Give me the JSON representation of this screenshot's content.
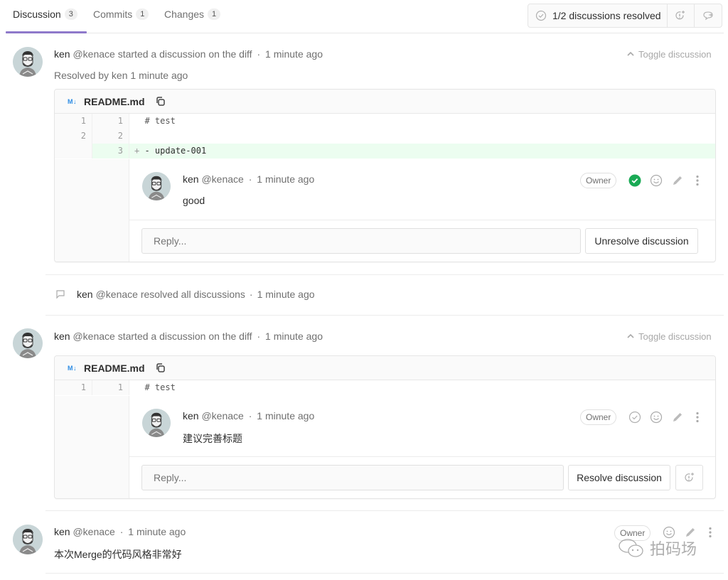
{
  "tabs": [
    {
      "label": "Discussion",
      "count": "3",
      "active": true
    },
    {
      "label": "Commits",
      "count": "1",
      "active": false
    },
    {
      "label": "Changes",
      "count": "1",
      "active": false
    }
  ],
  "resolved_status": {
    "text": "1/2 discussions resolved",
    "icons": [
      "check-circle-icon",
      "jump-to-unresolved-icon",
      "comment-next-icon"
    ]
  },
  "discussions": [
    {
      "author": "ken",
      "username": "@kenace",
      "action": "started a discussion on the diff",
      "separator": "·",
      "time": "1 minute ago",
      "resolved_text": "Resolved by ken 1 minute ago",
      "toggle_label": "Toggle discussion",
      "file": {
        "icon": "M↓",
        "name": "README.md"
      },
      "diff_lines": [
        {
          "old": "1",
          "new": "1",
          "prefix": " ",
          "text": "# test",
          "type": "context"
        },
        {
          "old": "2",
          "new": "2",
          "prefix": " ",
          "text": "",
          "type": "context"
        },
        {
          "old": "",
          "new": "3",
          "prefix": "+",
          "text": "- update-001",
          "type": "added"
        }
      ],
      "comment": {
        "author": "ken",
        "username": "@kenace",
        "separator": "·",
        "time": "1 minute ago",
        "body": "good",
        "badge": "Owner",
        "resolved": true
      },
      "reply_placeholder": "Reply...",
      "button_label": "Unresolve discussion"
    },
    {
      "author": "ken",
      "username": "@kenace",
      "action": "started a discussion on the diff",
      "separator": "·",
      "time": "1 minute ago",
      "toggle_label": "Toggle discussion",
      "file": {
        "icon": "M↓",
        "name": "README.md"
      },
      "diff_lines": [
        {
          "old": "1",
          "new": "1",
          "prefix": " ",
          "text": "# test",
          "type": "context"
        }
      ],
      "comment": {
        "author": "ken",
        "username": "@kenace",
        "separator": "·",
        "time": "1 minute ago",
        "body": "建议完善标题",
        "badge": "Owner",
        "resolved": false
      },
      "reply_placeholder": "Reply...",
      "button_label": "Resolve discussion"
    }
  ],
  "system_note": {
    "author": "ken",
    "text": "@kenace resolved all discussions",
    "separator": "·",
    "time": "1 minute ago"
  },
  "last_note": {
    "author": "ken",
    "username": "@kenace",
    "separator": "·",
    "time": "1 minute ago",
    "body": "本次Merge的代码风格非常好",
    "badge": "Owner"
  },
  "watermark": "拍码场",
  "colors": {
    "tab_indicator": "#6b4fbb",
    "resolved_green": "#1aaa55",
    "added_line_bg": "#ecfdf0",
    "md_icon": "#2f8de4"
  }
}
